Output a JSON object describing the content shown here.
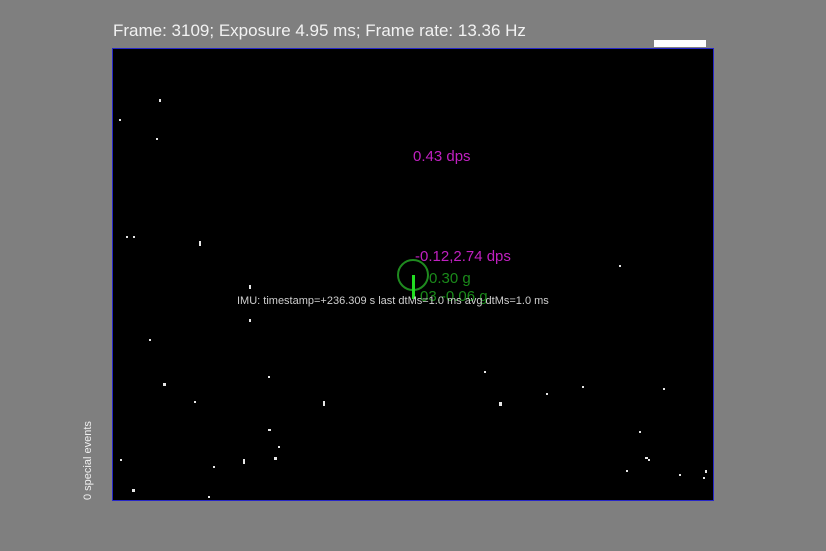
{
  "header": {
    "status": "Frame: 3109; Exposure 4.95 ms; Frame rate: 13.36 Hz"
  },
  "sidebar": {
    "special_events": "0 special events"
  },
  "overlay": {
    "yaw_rate": "0.43 dps",
    "pitch_roll_rate": "-0.12,2.74 dps",
    "accel_z": "0.30 g",
    "accel_xy": "03,-0.06 g",
    "imu_info": "IMU: timestamp=+236.309 s last dtMs=1.0   ms  avg dtMs=1.0   ms"
  },
  "colors": {
    "background": "#7f7f7f",
    "display_background": "#000000",
    "display_border": "#2626c8",
    "rate_text": "#c020c0",
    "accel_text": "#1a8a1a",
    "accel_vector": "#22dd22"
  }
}
